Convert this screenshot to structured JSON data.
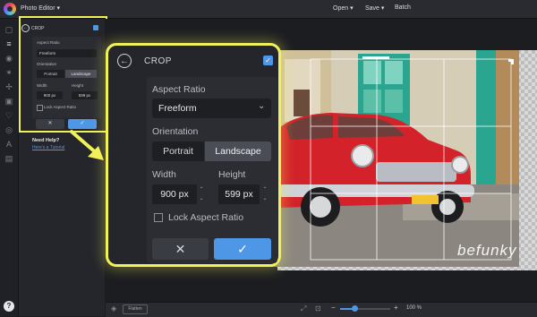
{
  "app": {
    "title": "Photo Editor",
    "title_chevron_icon": "chevron-down-icon",
    "logo_icon": "befunky-logo-icon"
  },
  "topbar": {
    "open_label": "Open",
    "save_label": "Save",
    "batch_label": "Batch",
    "chevron": "▾"
  },
  "crop_panel": {
    "title": "CROP",
    "aspect_ratio_label": "Aspect Ratio",
    "aspect_ratio_value": "Freeform",
    "orientation_label": "Orientation",
    "orientation_options": [
      "Portrait",
      "Landscape"
    ],
    "orientation_selected": "Landscape",
    "width_label": "Width",
    "height_label": "Height",
    "width_value": "900 px",
    "height_value": "599 px",
    "lock_label": "Lock Aspect Ratio",
    "lock_checked": false,
    "cancel_glyph": "✕",
    "apply_glyph": "✓",
    "back_glyph": "←",
    "check_glyph": "✓"
  },
  "help": {
    "title": "Need Help?",
    "link": "Here's a Tutorial",
    "button": "?"
  },
  "watermark": "befunky",
  "bottombar": {
    "flatten_label": "Flatten",
    "zoom_value": "100 %",
    "zoom_fraction": 0.27,
    "minus": "−",
    "plus": "+"
  },
  "colors": {
    "accent": "#4e96e6",
    "highlight": "#f1f25a",
    "car_red": "#d3222a",
    "door_teal": "#2aa58f"
  }
}
